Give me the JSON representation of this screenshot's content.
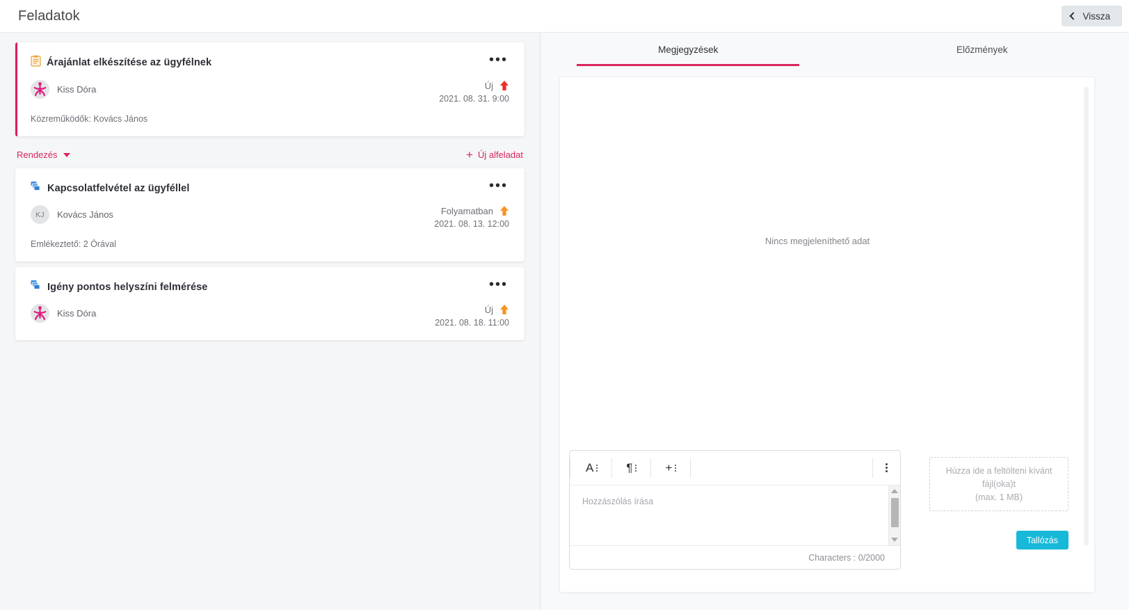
{
  "header": {
    "title": "Feladatok",
    "back_label": "Vissza",
    "back_icon": "chevron-left-icon"
  },
  "left": {
    "sort": {
      "label": "Rendezés",
      "icon": "caret-down-icon"
    },
    "add_subtask": {
      "label": "Új alfeladat",
      "icon": "plus-icon"
    },
    "cards": [
      {
        "icon": "clipboard-note-icon",
        "title": "Árajánlat elkészítése az ügyfélnek",
        "menu_icon": "ellipsis-icon",
        "assignee": "Kiss Dóra",
        "avatar_type": "logo",
        "avatar_initials": "",
        "status": "Új",
        "priority_icon": "arrow-up-icon",
        "priority_color": "#ee2b24",
        "date": "2021. 08. 31. 9:00",
        "footer": "Közreműködők: Kovács János",
        "accent": true
      },
      {
        "icon": "layers-icon",
        "title": "Kapcsolatfelvétel az ügyféllel",
        "menu_icon": "ellipsis-icon",
        "assignee": "Kovács János",
        "avatar_type": "initials",
        "avatar_initials": "KJ",
        "status": "Folyamatban",
        "priority_icon": "arrow-up-icon",
        "priority_color": "#f79321",
        "date": "2021. 08. 13. 12:00",
        "footer": "Emlékeztető: 2 Órával",
        "accent": false
      },
      {
        "icon": "layers-icon",
        "title": "Igény pontos helyszíni felmérése",
        "menu_icon": "ellipsis-icon",
        "assignee": "Kiss Dóra",
        "avatar_type": "logo",
        "avatar_initials": "",
        "status": "Új",
        "priority_icon": "arrow-up-icon",
        "priority_color": "#f79321",
        "date": "2021. 08. 18. 11:00",
        "footer": "",
        "accent": false
      }
    ]
  },
  "right": {
    "tabs": [
      {
        "label": "Megjegyzések",
        "active": true
      },
      {
        "label": "Előzmények",
        "active": false
      }
    ],
    "empty_message": "Nincs megjeleníthető adat",
    "editor": {
      "toolbar": [
        {
          "glyph": "A",
          "icon": "font-style-icon"
        },
        {
          "glyph": "¶",
          "icon": "paragraph-format-icon"
        },
        {
          "glyph": "+",
          "icon": "insert-icon"
        }
      ],
      "overflow_icon": "kebab-menu-icon",
      "placeholder": "Hozzászólás írása",
      "value": "",
      "char_count": "Characters : 0/2000"
    },
    "upload": {
      "dropzone_line1": "Húzza ide a feltölteni kívánt fájl(oka)t",
      "dropzone_line2": "(max. 1 MB)",
      "browse_label": "Tallózás"
    }
  },
  "colors": {
    "accent_pink": "#d9265c",
    "browse_blue": "#17b8d8",
    "priority_red": "#ee2b24",
    "priority_orange": "#f79321"
  }
}
